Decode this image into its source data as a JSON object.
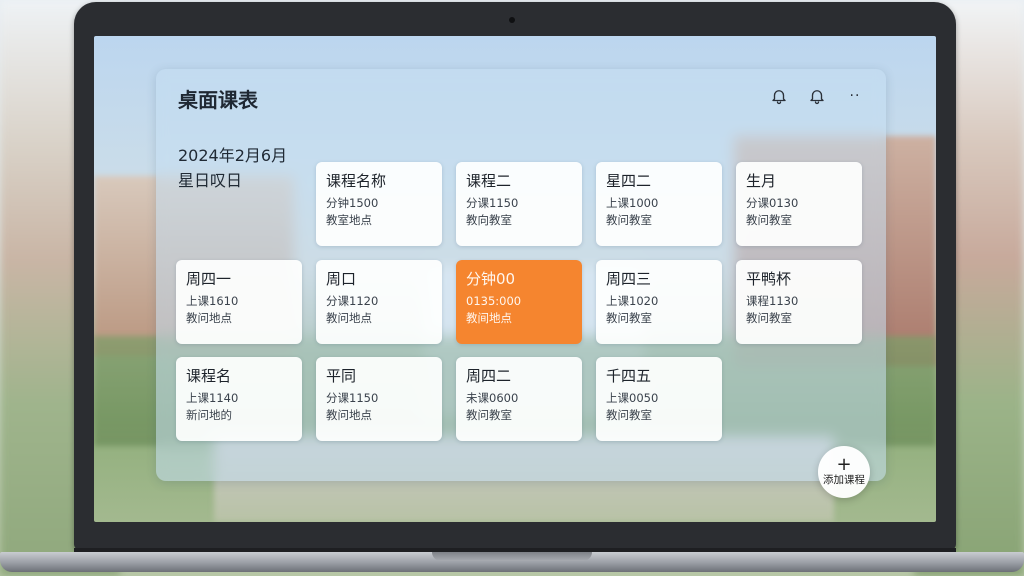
{
  "app": {
    "title": "桌面课表",
    "date_line1": "2024年2月6月",
    "date_line2": "星日叹日"
  },
  "header_icons": [
    "bell-icon",
    "bell-icon",
    "more-icon"
  ],
  "header_more_glyph": "··",
  "courses": [
    {
      "name": "课程名称",
      "time": "分钟1500",
      "location": "教室地点",
      "active": false
    },
    {
      "name": "课程二",
      "time": "分课1150",
      "location": "教向教室",
      "active": false
    },
    {
      "name": "星四二",
      "time": "上课1000",
      "location": "教问教室",
      "active": false
    },
    {
      "name": "生月",
      "time": "分课0130",
      "location": "教问教室",
      "active": false
    },
    {
      "name": "周四一",
      "time": "上课1610",
      "location": "教问地点",
      "active": false
    },
    {
      "name": "周口",
      "time": "分课1120",
      "location": "教问地点",
      "active": false
    },
    {
      "name": "分钟00",
      "time": "0135:000",
      "location": "教间地点",
      "active": true
    },
    {
      "name": "周四三",
      "time": "上课1020",
      "location": "教问教室",
      "active": false
    },
    {
      "name": "平鸭杯",
      "time": "课程1130",
      "location": "教问教室",
      "active": false
    },
    {
      "name": "课程名",
      "time": "上课1140",
      "location": "新问地的",
      "active": false
    },
    {
      "name": "平同",
      "time": "分课1150",
      "location": "教问地点",
      "active": false
    },
    {
      "name": "周四二",
      "time": "未课0600",
      "location": "教问教室",
      "active": false
    },
    {
      "name": "千四五",
      "time": "上课0050",
      "location": "教问教室",
      "active": false
    }
  ],
  "fab": {
    "plus": "+",
    "label": "添加课程"
  },
  "colors": {
    "accent": "#f5852f",
    "panel": "#c4def3",
    "card": "#ffffff"
  }
}
